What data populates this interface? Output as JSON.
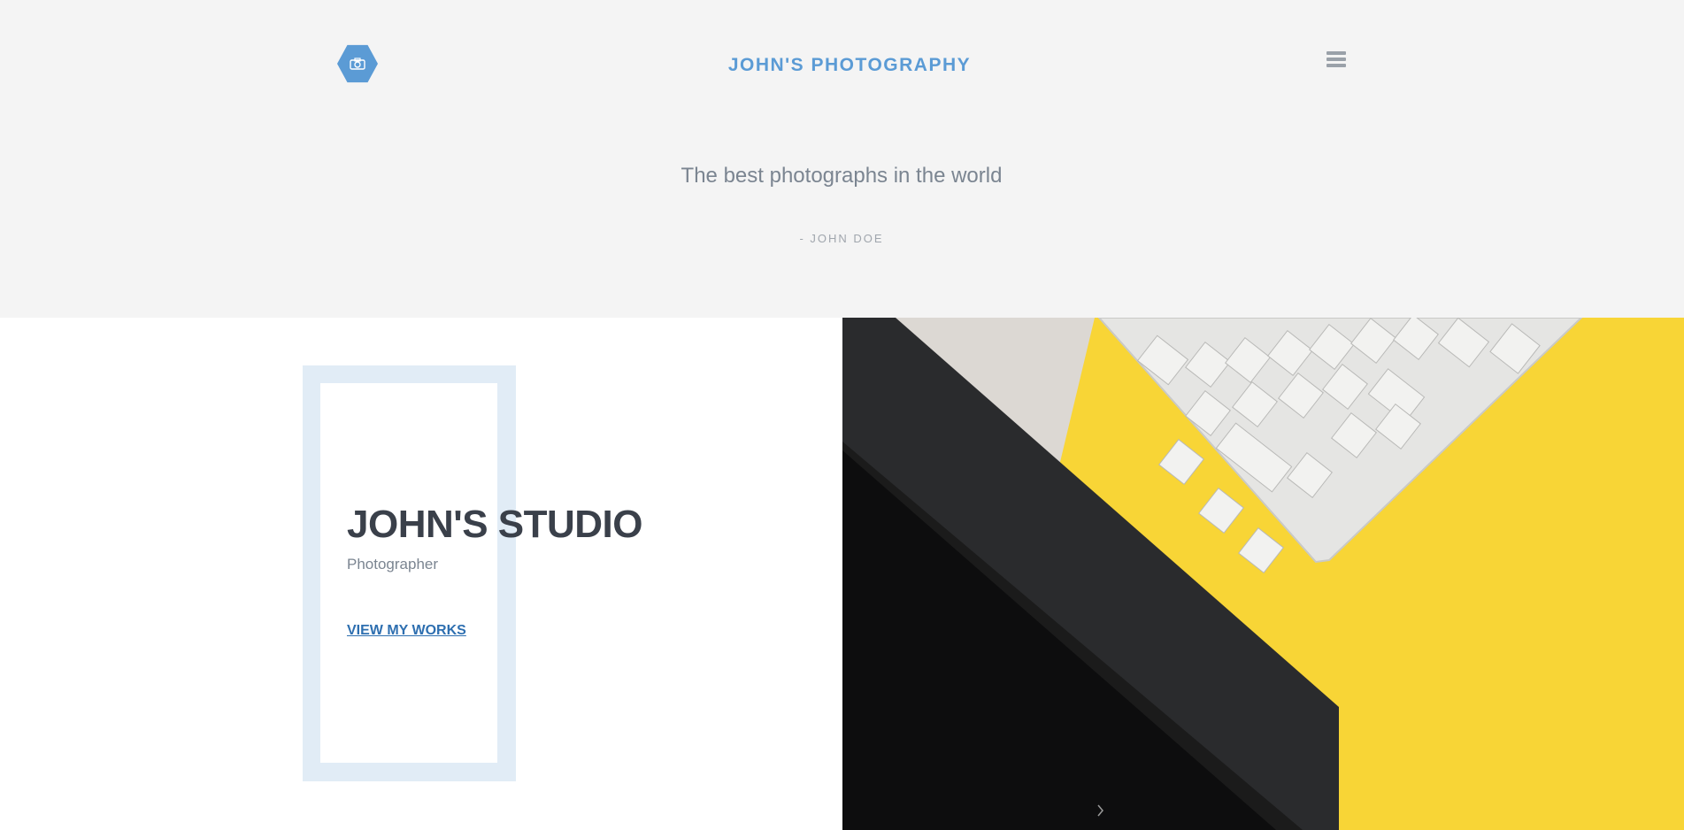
{
  "header": {
    "logo_icon": "camera-icon",
    "title": "JOHN'S PHOTOGRAPHY",
    "menu_icon": "hamburger-menu-icon"
  },
  "hero": {
    "tagline": "The best photographs in the world",
    "author": "- JOHN DOE"
  },
  "studio": {
    "title": "JOHN'S STUDIO",
    "role": "Photographer",
    "link_label": "VIEW MY WORKS"
  },
  "photo": {
    "subject": "keyboard-on-yellow-desk-image",
    "slider_arrow_icon": "chevron-right-icon"
  },
  "colors": {
    "accent": "#5b9bd5",
    "link": "#2e6fb0",
    "heading": "#3a404a",
    "muted": "#7b8591",
    "frame": "#e1ecf6",
    "header_bg": "#f4f4f4",
    "photo_yellow": "#f8d536"
  }
}
